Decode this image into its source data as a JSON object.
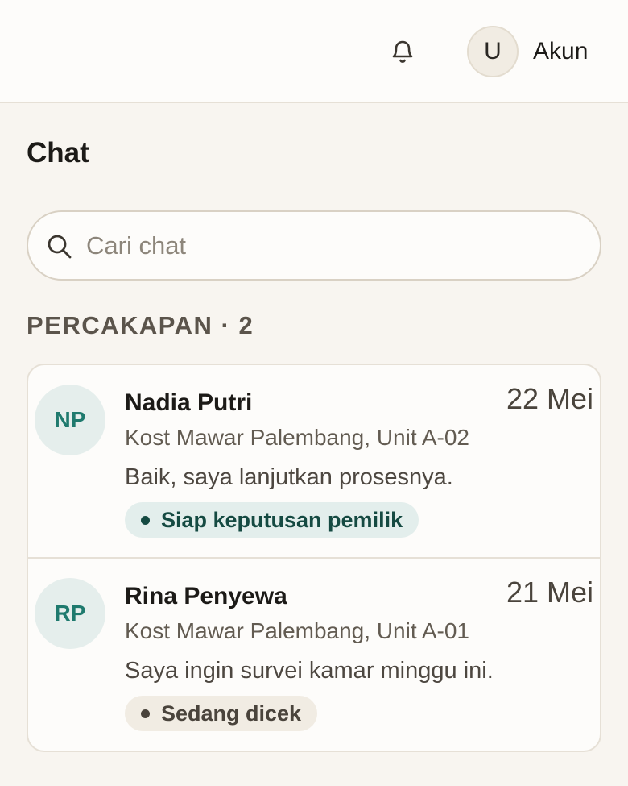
{
  "header": {
    "account_initial": "U",
    "account_label": "Akun",
    "notification_icon": "bell-icon"
  },
  "page": {
    "title": "Chat"
  },
  "search": {
    "placeholder": "Cari chat",
    "value": "",
    "icon": "search-icon"
  },
  "section": {
    "label": "PERCAKAPAN · 2"
  },
  "conversations": [
    {
      "initials": "NP",
      "name": "Nadia Putri",
      "date": "22 Mei",
      "property": "Kost Mawar Palembang, Unit A-02",
      "last_message": "Baik, saya lanjutkan prosesnya.",
      "status": "Siap keputusan pemilik",
      "status_color": "#154a42"
    },
    {
      "initials": "RP",
      "name": "Rina Penyewa",
      "date": "21 Mei",
      "property": "Kost Mawar Palembang, Unit A-01",
      "last_message": "Saya ingin survei kamar minggu ini.",
      "status": "Sedang dicek",
      "status_color": "#4a443c"
    }
  ],
  "colors": {
    "accent_teal": "#1f7a6e",
    "background": "#f8f5f0",
    "surface": "#fdfcfa",
    "border": "#e6e0d6"
  }
}
